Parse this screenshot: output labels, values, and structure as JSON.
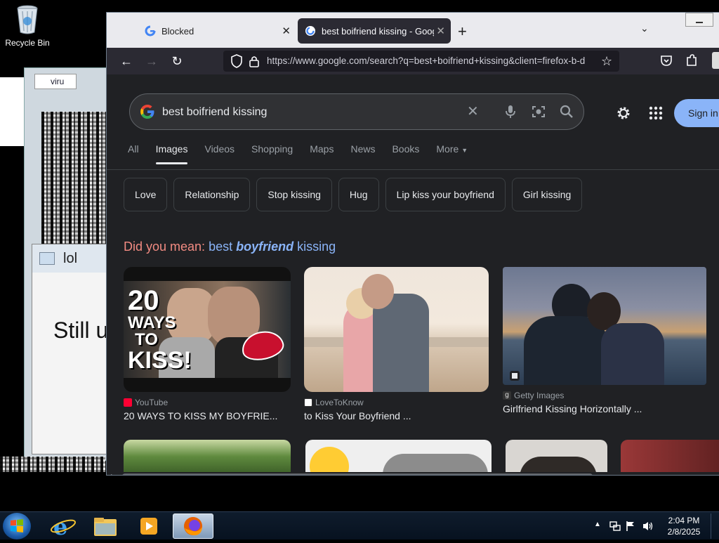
{
  "desktop": {
    "recycle_bin_label": "Recycle Bin",
    "bg_window_title": "lol",
    "bg_window_text": "Still u",
    "bg_window_tab": "viru"
  },
  "browser": {
    "tabs": [
      {
        "label": "Blocked",
        "favicon": "google-g-icon"
      },
      {
        "label": "best boifriend kissing - Google Search",
        "favicon": "google-g-icon",
        "active": true
      }
    ],
    "url": "https://www.google.com/search?q=best+boifriend+kissing&client=firefox-b-d",
    "url_host": "google.com"
  },
  "google": {
    "query": "best boifriend kissing",
    "sign_in_label": "Sign in",
    "tabs": [
      "All",
      "Images",
      "Videos",
      "Shopping",
      "Maps",
      "News",
      "Books",
      "More"
    ],
    "active_tab": "Images",
    "chips": [
      "Love",
      "Relationship",
      "Stop kissing",
      "Hug",
      "Lip kiss your boyfriend",
      "Girl kissing"
    ],
    "did_you_mean": {
      "prefix": "Did you mean:",
      "before": "best",
      "corrected": "boyfriend",
      "after": "kissing"
    },
    "results": [
      {
        "source": "YouTube",
        "title": "20 WAYS TO KISS MY BOYFRIE...",
        "thumb_text": [
          "20",
          "WAYS",
          "TO",
          "KISS!"
        ]
      },
      {
        "source": "LoveToKnow",
        "title": "to Kiss Your Boyfriend ..."
      },
      {
        "source": "Getty Images",
        "title": "Girlfriend Kissing Horizontally ..."
      }
    ]
  },
  "taskbar": {
    "time": "2:04 PM",
    "date": "2/8/2025"
  },
  "colors": {
    "google_bg": "#202124",
    "link_blue": "#8ab4f8",
    "did_you_mean_red": "#f28b82",
    "firefox_toolbar": "#2b2a33"
  }
}
